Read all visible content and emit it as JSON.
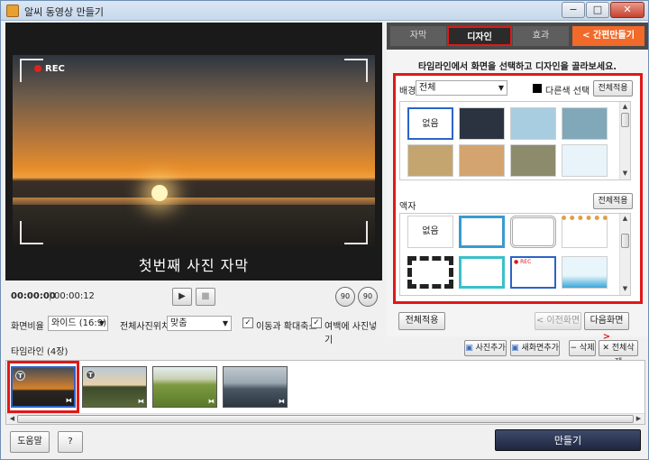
{
  "window": {
    "title": "알씨 동영상 만들기",
    "minimize": "−",
    "maximize": "□",
    "close": "✕"
  },
  "preview": {
    "rec": "REC",
    "caption": "첫번째 사진 자막",
    "time_current": "00:00:00",
    "time_total": "00:00:12",
    "play_icon": "▶",
    "stop_icon": "■",
    "rotate_left": "90",
    "rotate_right": "90"
  },
  "options": {
    "aspect_label": "화면비율",
    "aspect_value": "와이드 (16:9)",
    "position_label": "전체사진위치",
    "position_value": "맞춤",
    "move_zoom": "이동과 확대축소",
    "margin_photo": "여백에 사진넣기",
    "move_zoom_checked": "✓",
    "margin_photo_checked": "✓"
  },
  "tabs": {
    "subtitle": "자막",
    "design": "디자인",
    "effect": "효과",
    "quick": "간편만들기",
    "quick_arrow": "<"
  },
  "design": {
    "hint": "타임라인에서 화면을 선택하고 디자인을 골라보세요.",
    "bg_label": "배경",
    "bg_value": "전체",
    "other_color": "다른색 선택",
    "apply_all_1": "전체적용",
    "bg_none": "없음",
    "frame_label": "액자",
    "apply_all_2": "전체적용",
    "frame_none": "없음",
    "frame_rec": "● REC"
  },
  "panel_buttons": {
    "apply_all": "전체적용",
    "prev": "< 이전화면",
    "next": "다음화면",
    "next_arrow": ">"
  },
  "timeline": {
    "label": "타임라인 (4장)",
    "add_photo": "사진추가",
    "add_new_screen": "새화면추가",
    "delete": "삭제",
    "delete_all": "전체삭제",
    "minus": "−",
    "x": "✕",
    "clip_badge": "T",
    "clip_transition": "⧓"
  },
  "bottom": {
    "help": "도움말",
    "question": "?",
    "make": "만들기"
  },
  "colors": {
    "accent_red": "#e01818",
    "quick_orange": "#f26a2a",
    "make_button": "#1e2740"
  }
}
